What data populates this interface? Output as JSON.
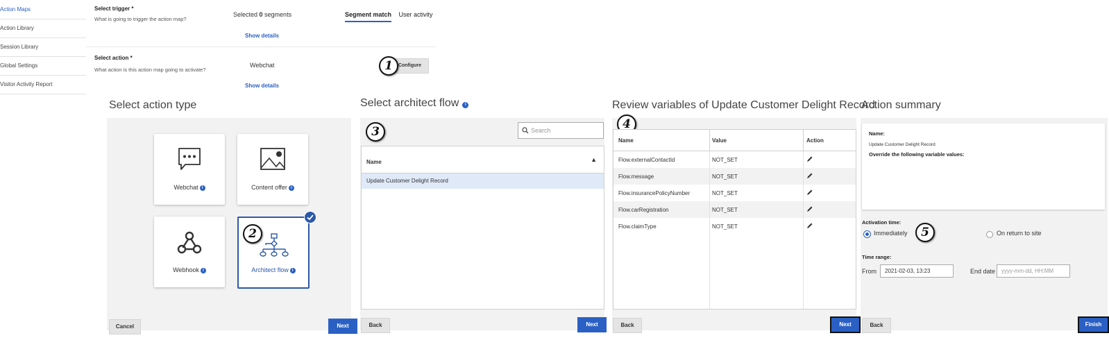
{
  "sidebar": {
    "items": [
      {
        "label": "Action Maps",
        "active": true
      },
      {
        "label": "Action Library",
        "active": false
      },
      {
        "label": "Session Library",
        "active": false
      },
      {
        "label": "Global Settings",
        "active": false
      },
      {
        "label": "Visitor Activity Report",
        "active": false
      }
    ]
  },
  "trigger": {
    "label": "Select trigger *",
    "sub": "What is going to trigger the action map?",
    "selected_prefix": "Selected ",
    "selected_count": "0",
    "selected_suffix": " segments",
    "tab_active": "Segment match",
    "tab_inactive": "User activity",
    "show_details": "Show details"
  },
  "action": {
    "label": "Select action *",
    "sub": "What action is this action map going to activate?",
    "value": "Webchat",
    "configure": "Configure",
    "show_details": "Show details"
  },
  "callouts": [
    "1",
    "2",
    "3",
    "4",
    "5"
  ],
  "panel1": {
    "title": "Select action type",
    "cards": [
      {
        "label": "Webchat",
        "icon": "chat-bubble-icon"
      },
      {
        "label": "Content offer",
        "icon": "image-icon"
      },
      {
        "label": "Webhook",
        "icon": "webhook-icon"
      },
      {
        "label": "Architect flow",
        "icon": "flow-icon"
      }
    ],
    "cancel": "Cancel",
    "next": "Next"
  },
  "panel2": {
    "title": "Select architect flow",
    "search_placeholder": "Search",
    "column": "Name",
    "rows": [
      "Update Customer Delight Record"
    ],
    "back": "Back",
    "next": "Next"
  },
  "panel3": {
    "title": "Review variables of Update Customer Delight Record",
    "columns": [
      "Name",
      "Value",
      "Action"
    ],
    "rows": [
      {
        "name": "Flow.externalContactId",
        "value": "NOT_SET"
      },
      {
        "name": "Flow.message",
        "value": "NOT_SET"
      },
      {
        "name": "Flow.insurancePolicyNumber",
        "value": "NOT_SET"
      },
      {
        "name": "Flow.carRegistration",
        "value": "NOT_SET"
      },
      {
        "name": "Flow.claimType",
        "value": "NOT_SET"
      }
    ],
    "back": "Back",
    "next": "Next"
  },
  "panel4": {
    "title": "Action summary",
    "name_label": "Name:",
    "name_value": "Update Customer Delight Record",
    "override": "Override the following variable values:",
    "activation_label": "Activation time:",
    "opt_immediately": "Immediately",
    "opt_return": "On return to site",
    "time_range_label": "Time range:",
    "from_label": "From",
    "from_value": "2021-02-03, 13:23",
    "end_label": "End date",
    "end_placeholder": "yyyy-mm-dd, HH:MM",
    "back": "Back",
    "finish": "Finish"
  },
  "colors": {
    "accent": "#2a60c4",
    "selected_border": "#2b58a8",
    "panel_bg": "#f2f2f2"
  }
}
